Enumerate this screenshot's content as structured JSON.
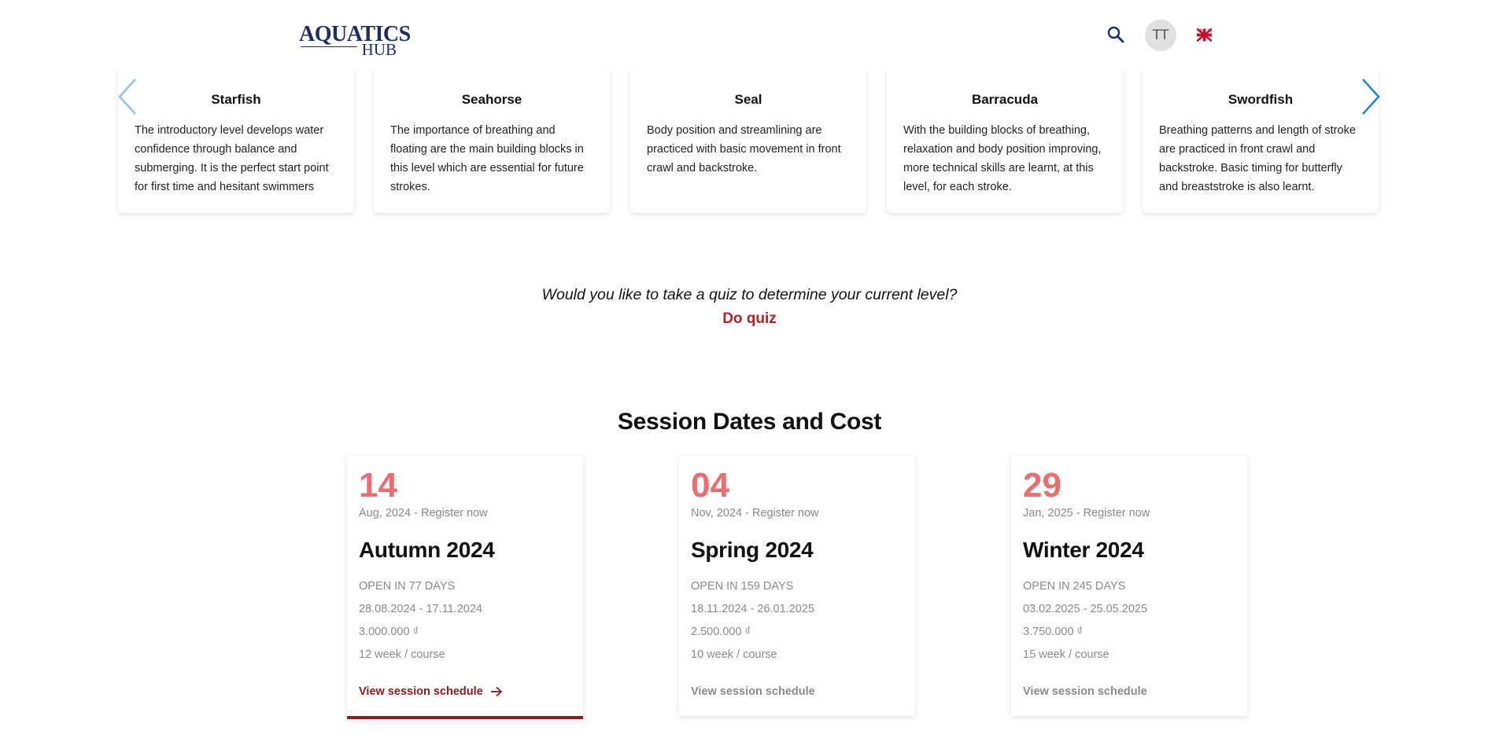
{
  "header": {
    "logo_main": "AQUATICS",
    "logo_sub": "HUB",
    "avatar_initials": "TT",
    "search_icon": "search-icon",
    "flag_icon": "uk-flag-icon"
  },
  "levels": [
    {
      "title": "Starfish",
      "desc": "The introductory level develops water confidence through balance and submerging. It is the perfect start point for first time and hesitant swimmers"
    },
    {
      "title": "Seahorse",
      "desc": "The importance of breathing and floating are the main building blocks in this level which are essential for future strokes."
    },
    {
      "title": "Seal",
      "desc": "Body position and streamlining are practiced with basic movement in front crawl and backstroke."
    },
    {
      "title": "Barracuda",
      "desc": "With the building blocks of breathing, relaxation and body position improving, more technical skills are learnt, at this level, for each stroke."
    },
    {
      "title": "Swordfish",
      "desc": "Breathing patterns and length of stroke are practiced in front crawl and backstroke. Basic timing for butterfly and breaststroke is also learnt."
    }
  ],
  "quiz": {
    "question": "Would you like to take a quiz to determine your current level?",
    "link": "Do quiz"
  },
  "sessions_title": "Session Dates and Cost",
  "sessions": [
    {
      "day": "14",
      "month": "Aug, 2024 - Register now",
      "name": "Autumn 2024",
      "open": "OPEN IN 77 DAYS",
      "dates": "28.08.2024 - 17.11.2024",
      "price": "3.000.000 ₫",
      "duration": "12 week / course",
      "link": "View session schedule"
    },
    {
      "day": "04",
      "month": "Nov, 2024 - Register now",
      "name": "Spring 2024",
      "open": "OPEN IN 159 DAYS",
      "dates": "18.11.2024 - 26.01.2025",
      "price": "2.500.000 ₫",
      "duration": "10 week / course",
      "link": "View session schedule"
    },
    {
      "day": "29",
      "month": "Jan, 2025 - Register now",
      "name": "Winter 2024",
      "open": "OPEN IN 245 DAYS",
      "dates": "03.02.2025 - 25.05.2025",
      "price": "3.750.000 ₫",
      "duration": "15 week / course",
      "link": "View session schedule"
    }
  ],
  "colors": {
    "brand_navy": "#1b2f63",
    "accent_red": "#b41e24",
    "dark_red": "#8f1a1f",
    "date_coral": "#ee6b6e",
    "arrow_blue": "#1e88e5"
  }
}
